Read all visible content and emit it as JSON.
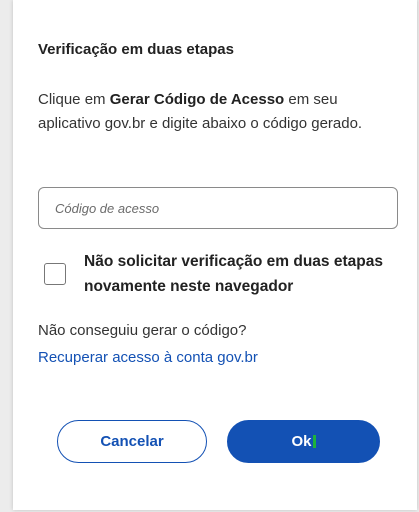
{
  "dialog": {
    "title": "Verificação em duas etapas",
    "instructions": {
      "before": "Clique em ",
      "bold": "Gerar Código de Acesso",
      "after": " em seu aplicativo gov.br e digite abaixo o código gerado."
    },
    "code_input": {
      "value": "",
      "placeholder": "Código de acesso"
    },
    "remember_checkbox": {
      "checked": false,
      "label": "Não solicitar verificação em duas etapas novamente neste navegador"
    },
    "help": {
      "question": "Não conseguiu gerar o código?",
      "link": "Recuperar acesso à conta gov.br"
    },
    "buttons": {
      "cancel": "Cancelar",
      "ok": "Ok"
    }
  },
  "colors": {
    "primary": "#1351b4",
    "background": "#ececec",
    "card": "#ffffff",
    "text": "#333333",
    "cursor_mark": "#1db33b"
  }
}
